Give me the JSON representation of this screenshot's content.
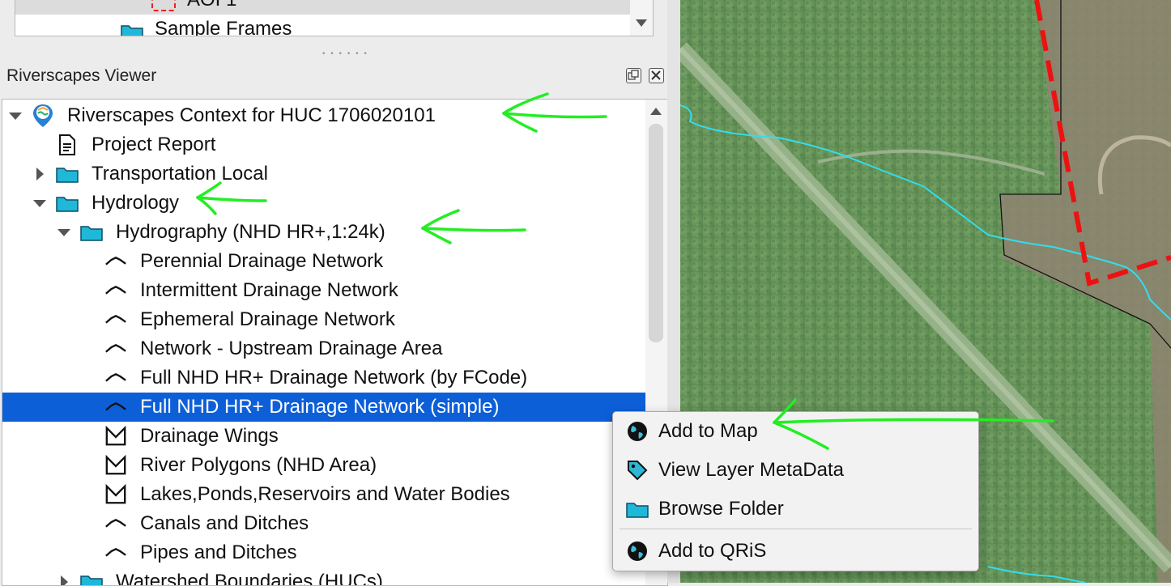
{
  "top_tree": {
    "items": [
      {
        "label": "AOI 1",
        "icon": "aoi-polygon-icon"
      },
      {
        "label": "Sample Frames",
        "icon": "folder-icon"
      }
    ]
  },
  "panel": {
    "title": "Riverscapes Viewer",
    "float_button": "float-panel-icon",
    "close_button": "close-panel-icon"
  },
  "tree": {
    "items": [
      {
        "label": "Riverscapes Context for HUC 1706020101",
        "icon": "riverscapes-project-icon",
        "expanded": true
      },
      {
        "label": "Project Report",
        "icon": "document-icon"
      },
      {
        "label": "Transportation Local",
        "icon": "folder-icon",
        "expanded": false
      },
      {
        "label": "Hydrology",
        "icon": "folder-icon",
        "expanded": true
      },
      {
        "label": "Hydrography (NHD HR+,1:24k)",
        "icon": "folder-icon",
        "expanded": true
      },
      {
        "label": "Perennial Drainage Network",
        "icon": "line-layer-icon"
      },
      {
        "label": "Intermittent Drainage Network",
        "icon": "line-layer-icon"
      },
      {
        "label": "Ephemeral Drainage Network",
        "icon": "line-layer-icon"
      },
      {
        "label": "Network - Upstream Drainage Area",
        "icon": "line-layer-icon"
      },
      {
        "label": "Full NHD HR+ Drainage Network (by FCode)",
        "icon": "line-layer-icon"
      },
      {
        "label": "Full NHD HR+ Drainage Network (simple)",
        "icon": "line-layer-icon",
        "selected": true
      },
      {
        "label": "Drainage Wings",
        "icon": "polygon-layer-icon"
      },
      {
        "label": "River Polygons (NHD Area)",
        "icon": "polygon-layer-icon"
      },
      {
        "label": "Lakes,Ponds,Reservoirs and Water Bodies",
        "icon": "polygon-layer-icon"
      },
      {
        "label": "Canals and Ditches",
        "icon": "line-layer-icon"
      },
      {
        "label": "Pipes and Ditches",
        "icon": "line-layer-icon"
      },
      {
        "label": "Watershed Boundaries (HUCs)",
        "icon": "folder-icon",
        "expanded": false
      }
    ]
  },
  "context_menu": {
    "items": [
      {
        "label": "Add to Map",
        "icon": "globe-icon"
      },
      {
        "label": "View Layer MetaData",
        "icon": "tag-icon"
      },
      {
        "label": "Browse Folder",
        "icon": "folder-icon"
      },
      {
        "label": "Add to QRiS",
        "icon": "globe-icon"
      }
    ]
  },
  "colors": {
    "selection": "#0d5fd8",
    "folder": "#1fb8d8",
    "annotation_arrow": "#22ee22",
    "map_boundary": "#ee1111",
    "stream": "#33ddee"
  }
}
